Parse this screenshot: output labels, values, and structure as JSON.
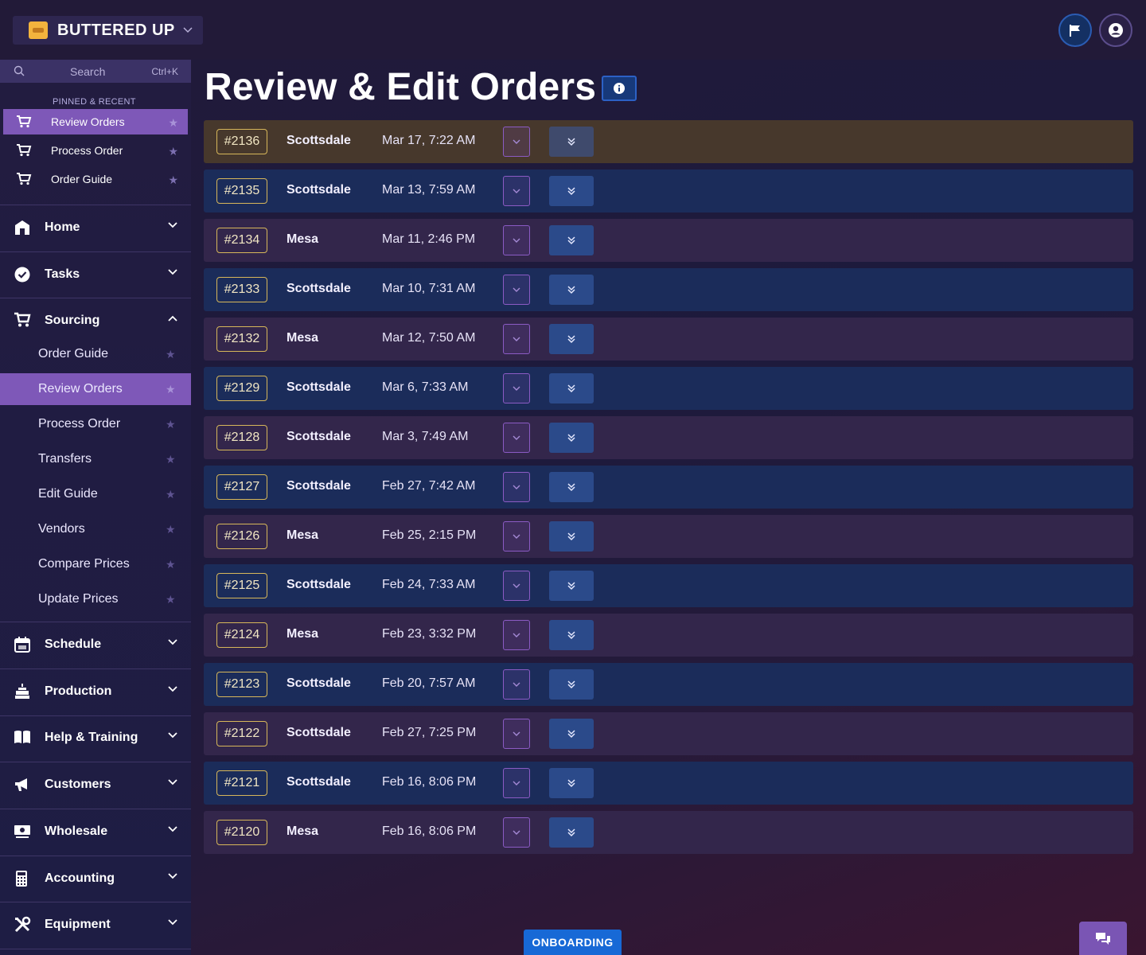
{
  "brand": {
    "name": "BUTTERED UP"
  },
  "search": {
    "placeholder": "Search",
    "shortcut": "Ctrl+K"
  },
  "pinned": {
    "header": "PINNED & RECENT",
    "items": [
      {
        "label": "Review Orders",
        "active": true
      },
      {
        "label": "Process Order",
        "active": false
      },
      {
        "label": "Order Guide",
        "active": false
      }
    ]
  },
  "nav": {
    "home": "Home",
    "tasks": "Tasks",
    "sourcing": "Sourcing",
    "sourcing_items": [
      {
        "label": "Order Guide"
      },
      {
        "label": "Review Orders"
      },
      {
        "label": "Process Order"
      },
      {
        "label": "Transfers"
      },
      {
        "label": "Edit Guide"
      },
      {
        "label": "Vendors"
      },
      {
        "label": "Compare Prices"
      },
      {
        "label": "Update Prices"
      }
    ],
    "schedule": "Schedule",
    "production": "Production",
    "help": "Help & Training",
    "customers": "Customers",
    "wholesale": "Wholesale",
    "accounting": "Accounting",
    "equipment": "Equipment"
  },
  "main": {
    "title": "Review & Edit Orders",
    "orders": [
      {
        "id": "#2136",
        "location": "Scottsdale",
        "date": "Mar 17, 7:22 AM",
        "tone": "orange"
      },
      {
        "id": "#2135",
        "location": "Scottsdale",
        "date": "Mar 13, 7:59 AM",
        "tone": "blue"
      },
      {
        "id": "#2134",
        "location": "Mesa",
        "date": "Mar 11, 2:46 PM",
        "tone": "purple"
      },
      {
        "id": "#2133",
        "location": "Scottsdale",
        "date": "Mar 10, 7:31 AM",
        "tone": "blue"
      },
      {
        "id": "#2132",
        "location": "Mesa",
        "date": "Mar 12, 7:50 AM",
        "tone": "purple"
      },
      {
        "id": "#2129",
        "location": "Scottsdale",
        "date": "Mar 6, 7:33 AM",
        "tone": "blue"
      },
      {
        "id": "#2128",
        "location": "Scottsdale",
        "date": "Mar 3, 7:49 AM",
        "tone": "purple"
      },
      {
        "id": "#2127",
        "location": "Scottsdale",
        "date": "Feb 27, 7:42 AM",
        "tone": "blue"
      },
      {
        "id": "#2126",
        "location": "Mesa",
        "date": "Feb 25, 2:15 PM",
        "tone": "purple"
      },
      {
        "id": "#2125",
        "location": "Scottsdale",
        "date": "Feb 24, 7:33 AM",
        "tone": "blue"
      },
      {
        "id": "#2124",
        "location": "Mesa",
        "date": "Feb 23, 3:32 PM",
        "tone": "purple"
      },
      {
        "id": "#2123",
        "location": "Scottsdale",
        "date": "Feb 20, 7:57 AM",
        "tone": "blue"
      },
      {
        "id": "#2122",
        "location": "Scottsdale",
        "date": "Feb 27, 7:25 PM",
        "tone": "purple"
      },
      {
        "id": "#2121",
        "location": "Scottsdale",
        "date": "Feb 16, 8:06 PM",
        "tone": "blue"
      },
      {
        "id": "#2120",
        "location": "Mesa",
        "date": "Feb 16, 8:06 PM",
        "tone": "purple"
      }
    ]
  },
  "footer": {
    "onboarding": "ONBOARDING"
  },
  "colors": {
    "accent": "#7e58b8",
    "gold": "#d7b75a",
    "blue_button": "#1769d6"
  }
}
